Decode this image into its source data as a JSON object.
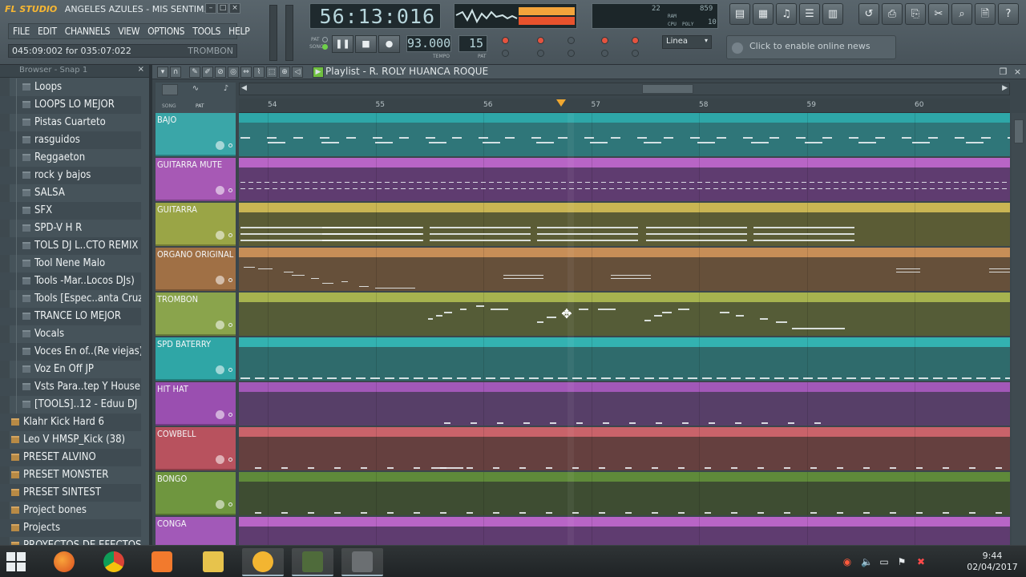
{
  "window": {
    "app_logo": "FL STUDIO",
    "title": "ANGELES AZULES - MIS SENTIM..."
  },
  "menu": [
    "FILE",
    "EDIT",
    "CHANNELS",
    "VIEW",
    "OPTIONS",
    "TOOLS",
    "HELP"
  ],
  "hint": {
    "text": "045:09:002 for 035:07:022",
    "channel": "TROMBON"
  },
  "transport": {
    "time": "56:13:016",
    "tempo": "93.000",
    "pattern": "15",
    "tempo_label": "TEMPO",
    "pattern_label": "PAT",
    "pat_song": [
      "PAT",
      "SONG"
    ],
    "snap": "Linea",
    "news": "Click to enable online news"
  },
  "cpu": {
    "value1": "22",
    "value2": "859",
    "value3": "10",
    "labels": [
      "RAM",
      "CPU",
      "POLY"
    ]
  },
  "browser": {
    "header": "Browser - Snap 1",
    "items": [
      {
        "label": "Loops",
        "level": 2
      },
      {
        "label": "LOOPS LO MEJOR",
        "level": 2
      },
      {
        "label": "Pistas Cuarteto",
        "level": 2
      },
      {
        "label": "rasguidos",
        "level": 2
      },
      {
        "label": "Reggaeton",
        "level": 2
      },
      {
        "label": "rock y bajos",
        "level": 2
      },
      {
        "label": "SALSA",
        "level": 2
      },
      {
        "label": "SFX",
        "level": 2
      },
      {
        "label": "SPD-V H R",
        "level": 2
      },
      {
        "label": "TOLS DJ L..CTO REMIX",
        "level": 2
      },
      {
        "label": "Tool Nene Malo",
        "level": 2
      },
      {
        "label": "Tools  -Mar..Locos DJs)",
        "level": 2
      },
      {
        "label": "Tools [Espec..anta Cruz",
        "level": 2
      },
      {
        "label": "TRANCE LO MEJOR",
        "level": 2
      },
      {
        "label": "Vocals",
        "level": 2
      },
      {
        "label": "Voces En of..(Re viejas)",
        "level": 2
      },
      {
        "label": "Voz En Off JP",
        "level": 2
      },
      {
        "label": "Vsts Para..tep Y House",
        "level": 2
      },
      {
        "label": "[TOOLS]..12 - Eduu DJ",
        "level": 2
      },
      {
        "label": "Klahr Kick Hard 6",
        "level": 1
      },
      {
        "label": "Leo V HMSP_Kick  (38)",
        "level": 1
      },
      {
        "label": "PRESET ALVINO",
        "level": 1
      },
      {
        "label": "PRESET MONSTER",
        "level": 1
      },
      {
        "label": "PRESET SINTEST",
        "level": 1
      },
      {
        "label": "Project bones",
        "level": 1
      },
      {
        "label": "Projects",
        "level": 1
      },
      {
        "label": "PROYECTOS DE EFECTOS",
        "level": 1
      }
    ]
  },
  "playlist": {
    "title": "Playlist - R. ROLY HUANCA ROQUE",
    "ruler": [
      "54",
      "55",
      "56",
      "57",
      "58",
      "59",
      "60"
    ],
    "ruler_side": [
      "SONG",
      "PAT"
    ],
    "tracks": [
      {
        "name": "BAJO",
        "header": "#3aa6a8",
        "top": "#2ea7a8",
        "body": "#2f7679",
        "note_kind": "dash-scatter"
      },
      {
        "name": "GUITARRA MUTE",
        "header": "#a759b5",
        "top": "#b865c6",
        "body": "#5f3c70",
        "note_kind": "dash-line"
      },
      {
        "name": "GUITARRA",
        "header": "#9aa546",
        "top": "#c9b553",
        "body": "#5b5c35",
        "note_kind": "blocks"
      },
      {
        "name": "ORGANO ORIGINAL",
        "header": "#a07045",
        "top": "#c78e57",
        "body": "#66503a",
        "note_kind": "melody"
      },
      {
        "name": "TROMBON",
        "header": "#8aa44c",
        "top": "#a6b34f",
        "body": "#555c37",
        "note_kind": "melody2"
      },
      {
        "name": "SPD BATERRY",
        "header": "#2fa6a6",
        "top": "#33b2b1",
        "body": "#2f6b6c",
        "note_kind": "dash-bottom"
      },
      {
        "name": "HIT HAT",
        "header": "#9a4fb0",
        "top": "#a258b8",
        "body": "#573f68",
        "note_kind": "sparse-bottom"
      },
      {
        "name": "COWBELL",
        "header": "#b8525e",
        "top": "#c9636a",
        "body": "#65403f",
        "note_kind": "dash-bottom2"
      },
      {
        "name": "BONGO",
        "header": "#6f963f",
        "top": "#5f8a3a",
        "body": "#3e4d32",
        "note_kind": "dash-bottom3"
      },
      {
        "name": "CONGA",
        "header": "#a259b8",
        "top": "#b865c6",
        "body": "#5f3c70",
        "note_kind": "none"
      }
    ]
  },
  "taskbar": {
    "time": "9:44",
    "date": "02/04/2017"
  }
}
